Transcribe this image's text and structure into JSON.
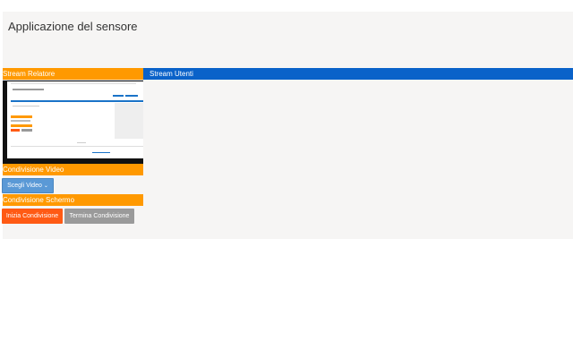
{
  "app": {
    "title": "Applicazione del sensore"
  },
  "panels": {
    "stream_relatore": "Stream Relatore",
    "stream_utenti": "Stream Utenti",
    "condivisione_video": "Condivisione Video",
    "condivisione_schermo": "Condivisione Schermo"
  },
  "buttons": {
    "scegli_video": "Scegli Video",
    "inizia_condivisione": "Inizia Condivisione",
    "termina_condivisione": "Termina Condivisione"
  },
  "icons": {
    "dropdown": "chevron-down-icon"
  },
  "colors": {
    "orange": "#ff9900",
    "blue": "#0a62c9",
    "start": "#ff5a14",
    "stop": "#9a9a9a",
    "video_button": "#5a99d6"
  }
}
